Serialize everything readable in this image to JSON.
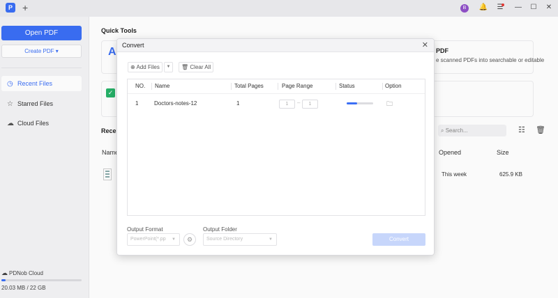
{
  "titlebar": {
    "app_logo": "P",
    "new_tab": "+",
    "avatar": "B"
  },
  "sidebar": {
    "open_pdf": "Open PDF",
    "create_pdf": "Create PDF ▾",
    "items": [
      {
        "label": "Recent Files",
        "icon": "clock-icon",
        "active": true
      },
      {
        "label": "Starred Files",
        "icon": "star-icon"
      },
      {
        "label": "Cloud Files",
        "icon": "cloud-icon"
      }
    ],
    "cloud_label": "PDNob Cloud",
    "storage_text": "20.03 MB  /  22 GB",
    "storage_used_fraction": 0.05
  },
  "main": {
    "quick_tools_title": "Quick Tools",
    "ocr_title": "PDF",
    "ocr_desc": "e scanned PDFs into searchable or editable",
    "recent_title": "Recen",
    "search_placeholder": "Search...",
    "columns": {
      "name": "Name",
      "opened": "Opened",
      "size": "Size"
    },
    "file": {
      "opened": "This week",
      "size": "625.9 KB"
    }
  },
  "dialog": {
    "title": "Convert",
    "add_files": "Add Files",
    "clear_all": "Clear All",
    "headers": [
      "NO.",
      "Name",
      "Total Pages",
      "Page Range",
      "Status",
      "Option"
    ],
    "row": {
      "no": "1",
      "name": "Doctors-notes-12",
      "total_pages": "1",
      "range_from": "1",
      "range_to": "1",
      "progress_fraction": 0.4
    },
    "output_format_label": "Output Format",
    "output_format_value": "PowerPoint(*.pp",
    "output_folder_label": "Output Folder",
    "output_folder_value": "Source Directory",
    "convert_label": "Convert"
  },
  "colors": {
    "accent": "#3b6ff5",
    "convert_disabled": "#c7d6fb"
  }
}
